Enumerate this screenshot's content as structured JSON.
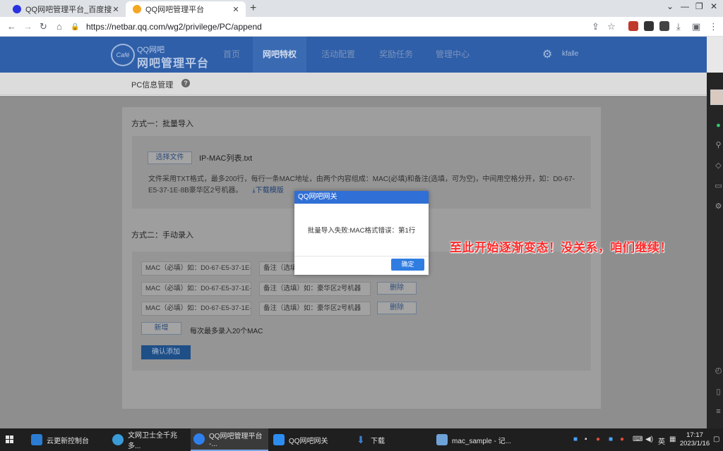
{
  "browser": {
    "tabs": [
      {
        "title": "QQ网吧管理平台_百度搜索",
        "active": false
      },
      {
        "title": "QQ网吧管理平台",
        "active": true
      }
    ],
    "new_tab": "+",
    "url": "https://netbar.qq.com/wg2/privilege/PC/append"
  },
  "site": {
    "logo_small": "QQ网吧",
    "logo_big": "网吧管理平台",
    "logo_badge": "Café",
    "nav": [
      "首页",
      "网吧特权",
      "活动配置",
      "奖励任务",
      "管理中心"
    ],
    "active_nav": "网吧特权",
    "user": "kfalle"
  },
  "subbar": {
    "title": "PC信息管理",
    "help": "?"
  },
  "section1": {
    "title": "方式一：批量导入",
    "choose_file": "选择文件",
    "filename": "IP-MAC列表.txt",
    "description": "文件采用TXT格式，最多200行，每行一条MAC地址，由两个内容组成：MAC(必填)和备注(选填，可为空)，中间用空格分开，如：D0-67-E5-37-1E-8B豪华区2号机器。",
    "download": "下载模版"
  },
  "section2": {
    "title": "方式二：手动录入",
    "rows": [
      {
        "mac": "MAC（必填）如：D0-67-E5-37-1E-8",
        "note": "备注（选填）",
        "delete": ""
      },
      {
        "mac": "MAC（必填）如：D0-67-E5-37-1E-8",
        "note": "备注（选填）如：豪华区2号机器",
        "delete": "删除"
      },
      {
        "mac": "MAC（必填）如：D0-67-E5-37-1E-8",
        "note": "备注（选填）如：豪华区2号机器",
        "delete": "删除"
      }
    ],
    "add": "新增",
    "tip": "每次最多录入20个MAC",
    "confirm": "确认添加"
  },
  "modal": {
    "title": "QQ网吧网关",
    "message": "批量导入失败:MAC格式错误：第1行",
    "ok": "确定"
  },
  "annotation": "至此开始逐渐变态！没关系，咱们继续！",
  "taskbar": {
    "items": [
      {
        "label": "云更新控制台",
        "color": "#2b7cd3"
      },
      {
        "label": "文网卫士全千兆多...",
        "color": "#3a9bd9"
      },
      {
        "label": "QQ网吧管理平台 -...",
        "color": "#2f80ed"
      },
      {
        "label": "QQ网吧网关",
        "color": "#2d8cf0"
      },
      {
        "label": "下载",
        "color": "#3c7fd1"
      },
      {
        "label": "mac_sample - 记...",
        "color": "#6fa3d8"
      }
    ],
    "ime": "英",
    "time": "17:17",
    "date": "2023/1/16"
  }
}
